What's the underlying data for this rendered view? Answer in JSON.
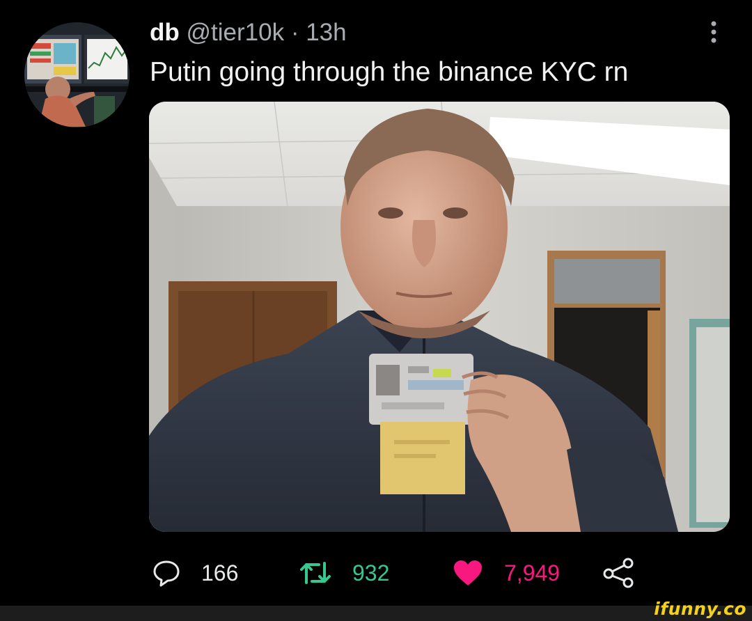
{
  "tweet": {
    "display_name": "db",
    "handle": "@tier10k",
    "separator": "·",
    "time": "13h",
    "text": "Putin going through the binance KYC rn"
  },
  "actions": {
    "reply_count": "166",
    "retweet_count": "932",
    "like_count": "7,949"
  },
  "icons": {
    "reply": "speech-bubble-icon",
    "retweet": "retweet-arrows-icon",
    "like": "heart-icon",
    "share": "share-icon",
    "more": "vertical-dots-icon"
  },
  "colors": {
    "background": "#000000",
    "retweet_active": "#35c88f",
    "like_active": "#f91880",
    "secondary_text": "#a9adb1",
    "watermark": "#f4d21c"
  },
  "watermark": {
    "text": "ifunny.co"
  }
}
